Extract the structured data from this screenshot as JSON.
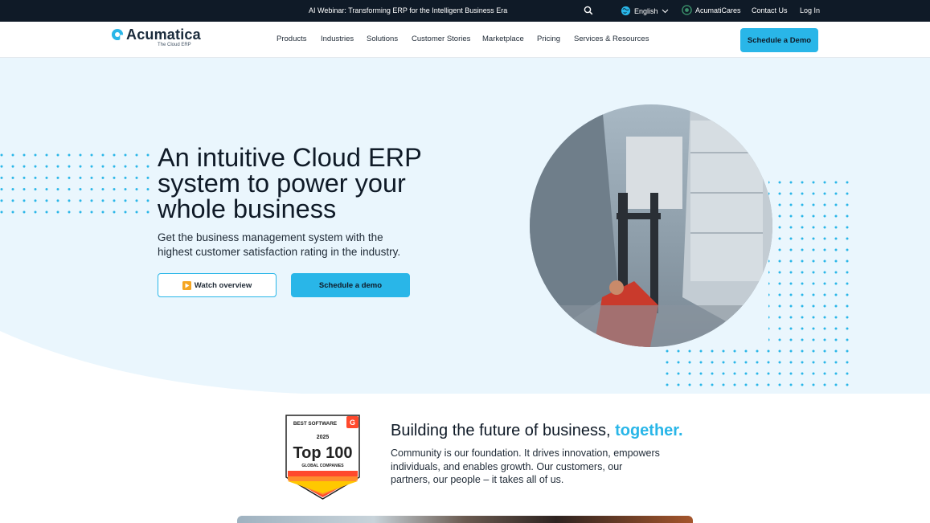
{
  "topbar": {
    "promo": "AI Webinar: Transforming ERP for the Intelligent Business Era",
    "search_icon": "search-icon",
    "language": "English",
    "cares": "AcumatiCares",
    "contact": "Contact Us",
    "login": "Log In"
  },
  "logo": {
    "name": "Acumatica",
    "tagline": "The Cloud ERP"
  },
  "nav": {
    "items": [
      "Products",
      "Industries",
      "Solutions",
      "Customer Stories",
      "Marketplace",
      "Pricing",
      "Services & Resources"
    ],
    "cta": "Schedule a Demo"
  },
  "hero": {
    "heading": "An intuitive Cloud ERP system to power your whole business",
    "subheading": "Get the business management system with the highest customer satisfaction rating in the industry.",
    "watch_label": "Watch overview",
    "demo_label": "Schedule a demo"
  },
  "section2": {
    "badge": {
      "top": "BEST SOFTWARE",
      "year": "2025",
      "main": "Top 100",
      "sub": "GLOBAL COMPANIES"
    },
    "title": "Building the future of business,",
    "title_accent": "together.",
    "text": "Community is our foundation. It drives innovation, empowers individuals, and enables growth. Our customers, our partners, our people – it takes all of us."
  },
  "colors": {
    "accent": "#29b6e8",
    "dark": "#0f1a27",
    "hero_bg": "#eaf6fd"
  }
}
